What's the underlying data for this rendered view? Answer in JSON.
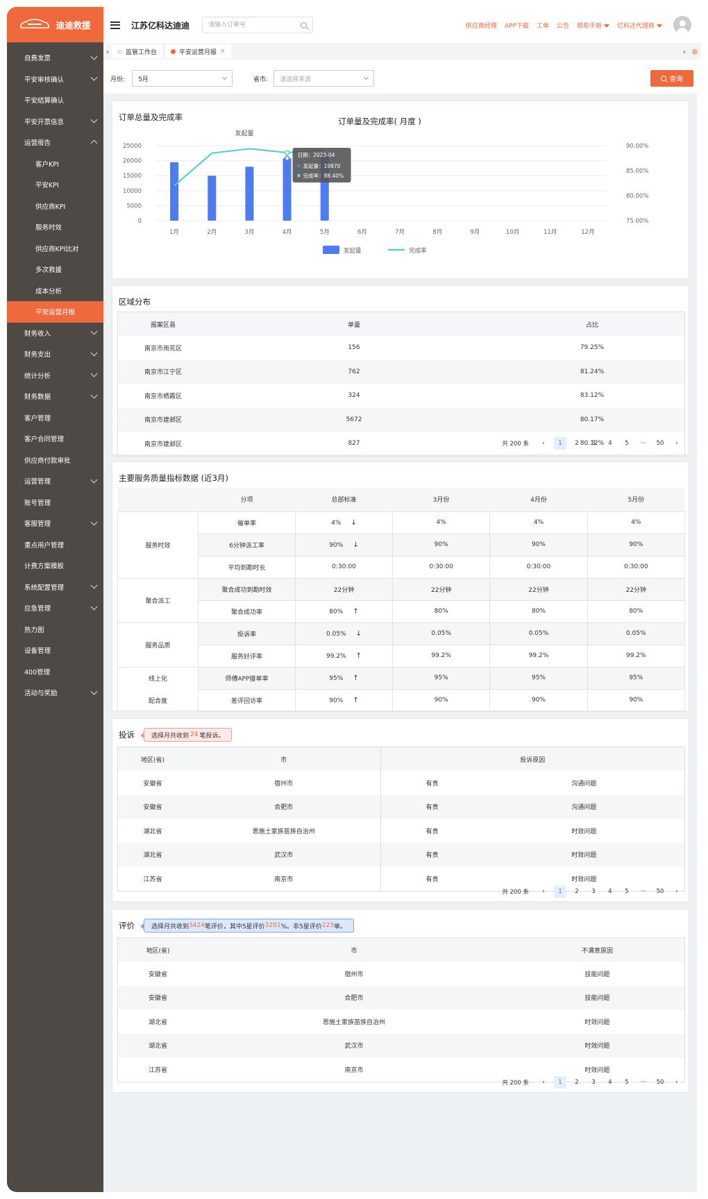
{
  "brand": {
    "logo_text": "迪迪救援",
    "accent": "#f0693d"
  },
  "header": {
    "company": "江苏亿科达迪迪",
    "search_placeholder": "请输入订单号",
    "links": [
      "供应商经理",
      "APP下载",
      "工单",
      "公告"
    ],
    "help_menu": "帮助手册",
    "agent_menu": "亿科达代理商"
  },
  "sidebar": {
    "items": [
      {
        "label": "自费发票",
        "chevron": "down"
      },
      {
        "label": "平安审核确认",
        "chevron": "down"
      },
      {
        "label": "平安结算确认"
      },
      {
        "label": "平安开票信息",
        "chevron": "down"
      },
      {
        "label": "运营报告",
        "chevron": "up"
      },
      {
        "label": "客户KPI",
        "sub": true
      },
      {
        "label": "平安KPI",
        "sub": true
      },
      {
        "label": "供应商KPI",
        "sub": true
      },
      {
        "label": "服务时效",
        "sub": true
      },
      {
        "label": "供应商KPI比对",
        "sub": true
      },
      {
        "label": "多次救援",
        "sub": true
      },
      {
        "label": "成本分析",
        "sub": true
      },
      {
        "label": "平安运营月报",
        "sub": true,
        "active": true
      },
      {
        "label": "财务收入",
        "chevron": "down"
      },
      {
        "label": "财务支出",
        "chevron": "down"
      },
      {
        "label": "统计分析",
        "chevron": "down"
      },
      {
        "label": "财务数据",
        "chevron": "down"
      },
      {
        "label": "客户管理"
      },
      {
        "label": "客户合同管理"
      },
      {
        "label": "供应商付款审批"
      },
      {
        "label": "运营管理",
        "chevron": "down"
      },
      {
        "label": "账号管理"
      },
      {
        "label": "客服管理",
        "chevron": "down"
      },
      {
        "label": "重点用户管理"
      },
      {
        "label": "计费方案模板"
      },
      {
        "label": "系统配置管理",
        "chevron": "down"
      },
      {
        "label": "应急管理",
        "chevron": "down"
      },
      {
        "label": "热力图"
      },
      {
        "label": "设备管理"
      },
      {
        "label": "400管理"
      },
      {
        "label": "活动与奖励",
        "chevron": "down"
      }
    ]
  },
  "tabs": [
    {
      "label": "监管工作台",
      "active": false
    },
    {
      "label": "平安运营月报",
      "active": true,
      "close": "×"
    }
  ],
  "filter": {
    "month_label": "月份:",
    "month_value": "5月",
    "province_label": "省市:",
    "province_placeholder": "请选择来源",
    "query_button": "查询"
  },
  "order_card": {
    "title": "订单总量及完成率"
  },
  "chart_data": {
    "type": "bar",
    "title": "订单量及完成率( 月度 )",
    "subtitle": "发起量",
    "categories": [
      "1月",
      "2月",
      "3月",
      "4月",
      "5月",
      "6月",
      "7月",
      "8月",
      "9月",
      "10月",
      "11月",
      "12月"
    ],
    "series": [
      {
        "name": "发起量",
        "type": "bar",
        "color": "#4e7cf0",
        "values": [
          19500,
          15000,
          18000,
          20800,
          22000,
          null,
          null,
          null,
          null,
          null,
          null,
          null
        ]
      },
      {
        "name": "完成率",
        "type": "line",
        "color": "#5ccccc",
        "values": [
          82.0,
          88.5,
          89.4,
          88.6,
          89.2,
          null,
          null,
          null,
          null,
          null,
          null,
          null
        ]
      }
    ],
    "y_left": {
      "ticks": [
        "25000",
        "20000",
        "15000",
        "10000",
        "5000",
        "0"
      ],
      "range": [
        0,
        25000
      ]
    },
    "y_right": {
      "ticks": [
        "90.00%",
        "85.00%",
        "80.00%",
        "75.00%"
      ],
      "range": [
        75,
        90
      ]
    },
    "tooltip": {
      "date": "日期：2023-04",
      "count": "发起量：19870",
      "rate": "完成率：88.40%"
    },
    "legend": "bottom"
  },
  "region": {
    "title": "区域分布",
    "headers": [
      "报案区县",
      "单量",
      "占比"
    ],
    "rows": [
      [
        "南京市雨花区",
        "156",
        "79.25%"
      ],
      [
        "南京市江宁区",
        "762",
        "81.24%"
      ],
      [
        "南京市栖霞区",
        "324",
        "83.12%"
      ],
      [
        "南京市建邺区",
        "5672",
        "80.17%"
      ],
      [
        "南京市建邺区",
        "827",
        "80.12%"
      ]
    ],
    "pager": {
      "total": "共 200 条",
      "pages": [
        "1",
        "2",
        "3",
        "4",
        "5",
        "···",
        "50"
      ]
    }
  },
  "quality": {
    "title": "主要服务质量指标数据 (近3月)",
    "headers": [
      "",
      "分项",
      "总部标准",
      "3月份",
      "4月份",
      "5月份"
    ],
    "groups": [
      {
        "name": "服务时效",
        "rows": [
          {
            "item": "催单率",
            "std": "4%",
            "arrow": "↓",
            "m3": "4%",
            "m4": "4%",
            "m5": "4%"
          },
          {
            "item": "6分钟派工率",
            "std": "90%",
            "arrow": "↓",
            "m3": "90%",
            "m4": "90%",
            "m5": "90%"
          },
          {
            "item": "平均到勘时长",
            "std": "0:30:00",
            "arrow": "",
            "m3": "0:30:00",
            "m4": "0:30:00",
            "m5": "0:30:00"
          }
        ]
      },
      {
        "name": "聚合派工",
        "rows": [
          {
            "item": "聚合成功到勘时效",
            "std": "22分钟",
            "arrow": "",
            "m3": "22分钟",
            "m4": "22分钟",
            "m5": "22分钟"
          },
          {
            "item": "聚合成功率",
            "std": "80%",
            "arrow": "↑",
            "m3": "80%",
            "m4": "80%",
            "m5": "80%"
          }
        ]
      },
      {
        "name": "服务品质",
        "rows": [
          {
            "item": "投诉率",
            "std": "0.05%",
            "arrow": "↓",
            "m3": "0.05%",
            "m4": "0.05%",
            "m5": "0.05%"
          },
          {
            "item": "服务好评率",
            "std": "99.2%",
            "arrow": "↑",
            "m3": "99.2%",
            "m4": "99.2%",
            "m5": "99.2%"
          }
        ]
      },
      {
        "name": "线上化",
        "name2": "配合度",
        "rows": [
          {
            "item": "师傅APP接单率",
            "std": "95%",
            "arrow": "↑",
            "m3": "95%",
            "m4": "95%",
            "m5": "95%"
          },
          {
            "item": "差评回访率",
            "std": "90%",
            "arrow": "↑",
            "m3": "90%",
            "m4": "90%",
            "m5": "90%"
          }
        ]
      }
    ]
  },
  "complaint": {
    "title": "投诉",
    "note_prefix": "选择月共收到",
    "note_count": "24",
    "note_suffix": "笔投诉。",
    "headers": [
      "地区(省)",
      "市",
      "投诉原因"
    ],
    "rows": [
      [
        "安徽省",
        "宿州市",
        "有责",
        "沟通问题"
      ],
      [
        "安徽省",
        "合肥市",
        "有责",
        "沟通问题"
      ],
      [
        "湖北省",
        "恩施土家族苗族自治州",
        "有责",
        "时效问题"
      ],
      [
        "湖北省",
        "武汉市",
        "有责",
        "时效问题"
      ],
      [
        "江苏省",
        "南京市",
        "有责",
        "时效问题"
      ]
    ],
    "pager": {
      "total": "共 200 条",
      "pages": [
        "1",
        "2",
        "3",
        "4",
        "5",
        "···",
        "50"
      ]
    }
  },
  "evaluation": {
    "title": "评价",
    "note": [
      "选择月共收到",
      "3424",
      "笔评价，其中5星评价",
      "3201",
      "%。非5星评价",
      "223",
      "单。"
    ],
    "headers": [
      "地区(省)",
      "市",
      "不满意原因"
    ],
    "rows": [
      [
        "安徽省",
        "宿州市",
        "技能问题"
      ],
      [
        "安徽省",
        "合肥市",
        "技能问题"
      ],
      [
        "湖北省",
        "恩施土家族苗族自治州",
        "时效问题"
      ],
      [
        "湖北省",
        "武汉市",
        "时效问题"
      ],
      [
        "江苏省",
        "南京市",
        "时效问题"
      ]
    ],
    "pager": {
      "total": "共 200 条",
      "pages": [
        "1",
        "2",
        "3",
        "4",
        "5",
        "···",
        "50"
      ]
    }
  }
}
